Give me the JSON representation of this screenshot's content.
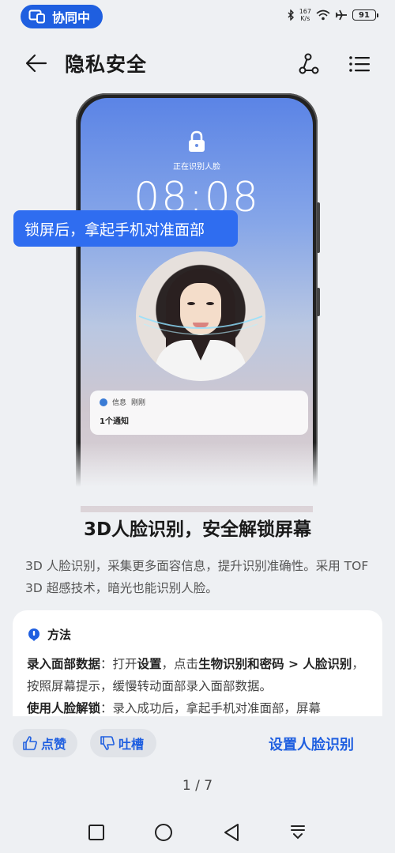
{
  "status_bar": {
    "collab_label": "协同中",
    "net_speed_value": "167",
    "net_speed_unit": "K/s",
    "battery": "91"
  },
  "header": {
    "title": "隐私安全"
  },
  "illustration": {
    "lock_status_text": "正在识别人脸",
    "time": "08:08",
    "tooltip": "锁屏后，拿起手机对准面部",
    "notification_app": "信息",
    "notification_time": "刚刚",
    "notification_body": "1个通知"
  },
  "feature": {
    "title": "3D人脸识别，安全解锁屏幕",
    "desc": "3D 人脸识别，采集更多面容信息，提升识别准确性。采用 TOF 3D 超感技术，暗光也能识别人脸。"
  },
  "method": {
    "heading": "方法",
    "step1_bold": "录入面部数据",
    "step1_a": "：打开",
    "step1_b": "设置",
    "step1_c": "，点击",
    "step1_d": "生物识别和密码 > 人脸识别",
    "step1_e": "，按照屏幕提示，缓慢转动面部录入面部数据。",
    "step2_bold": "使用人脸解锁",
    "step2_text": "：录入成功后，拿起手机对准面部，屏幕"
  },
  "actions": {
    "like": "点赞",
    "dislike": "吐槽",
    "setup": "设置人脸识别"
  },
  "pager": "1 / 7",
  "colors": {
    "accent": "#1f5fe0",
    "background": "#eef0f3"
  }
}
